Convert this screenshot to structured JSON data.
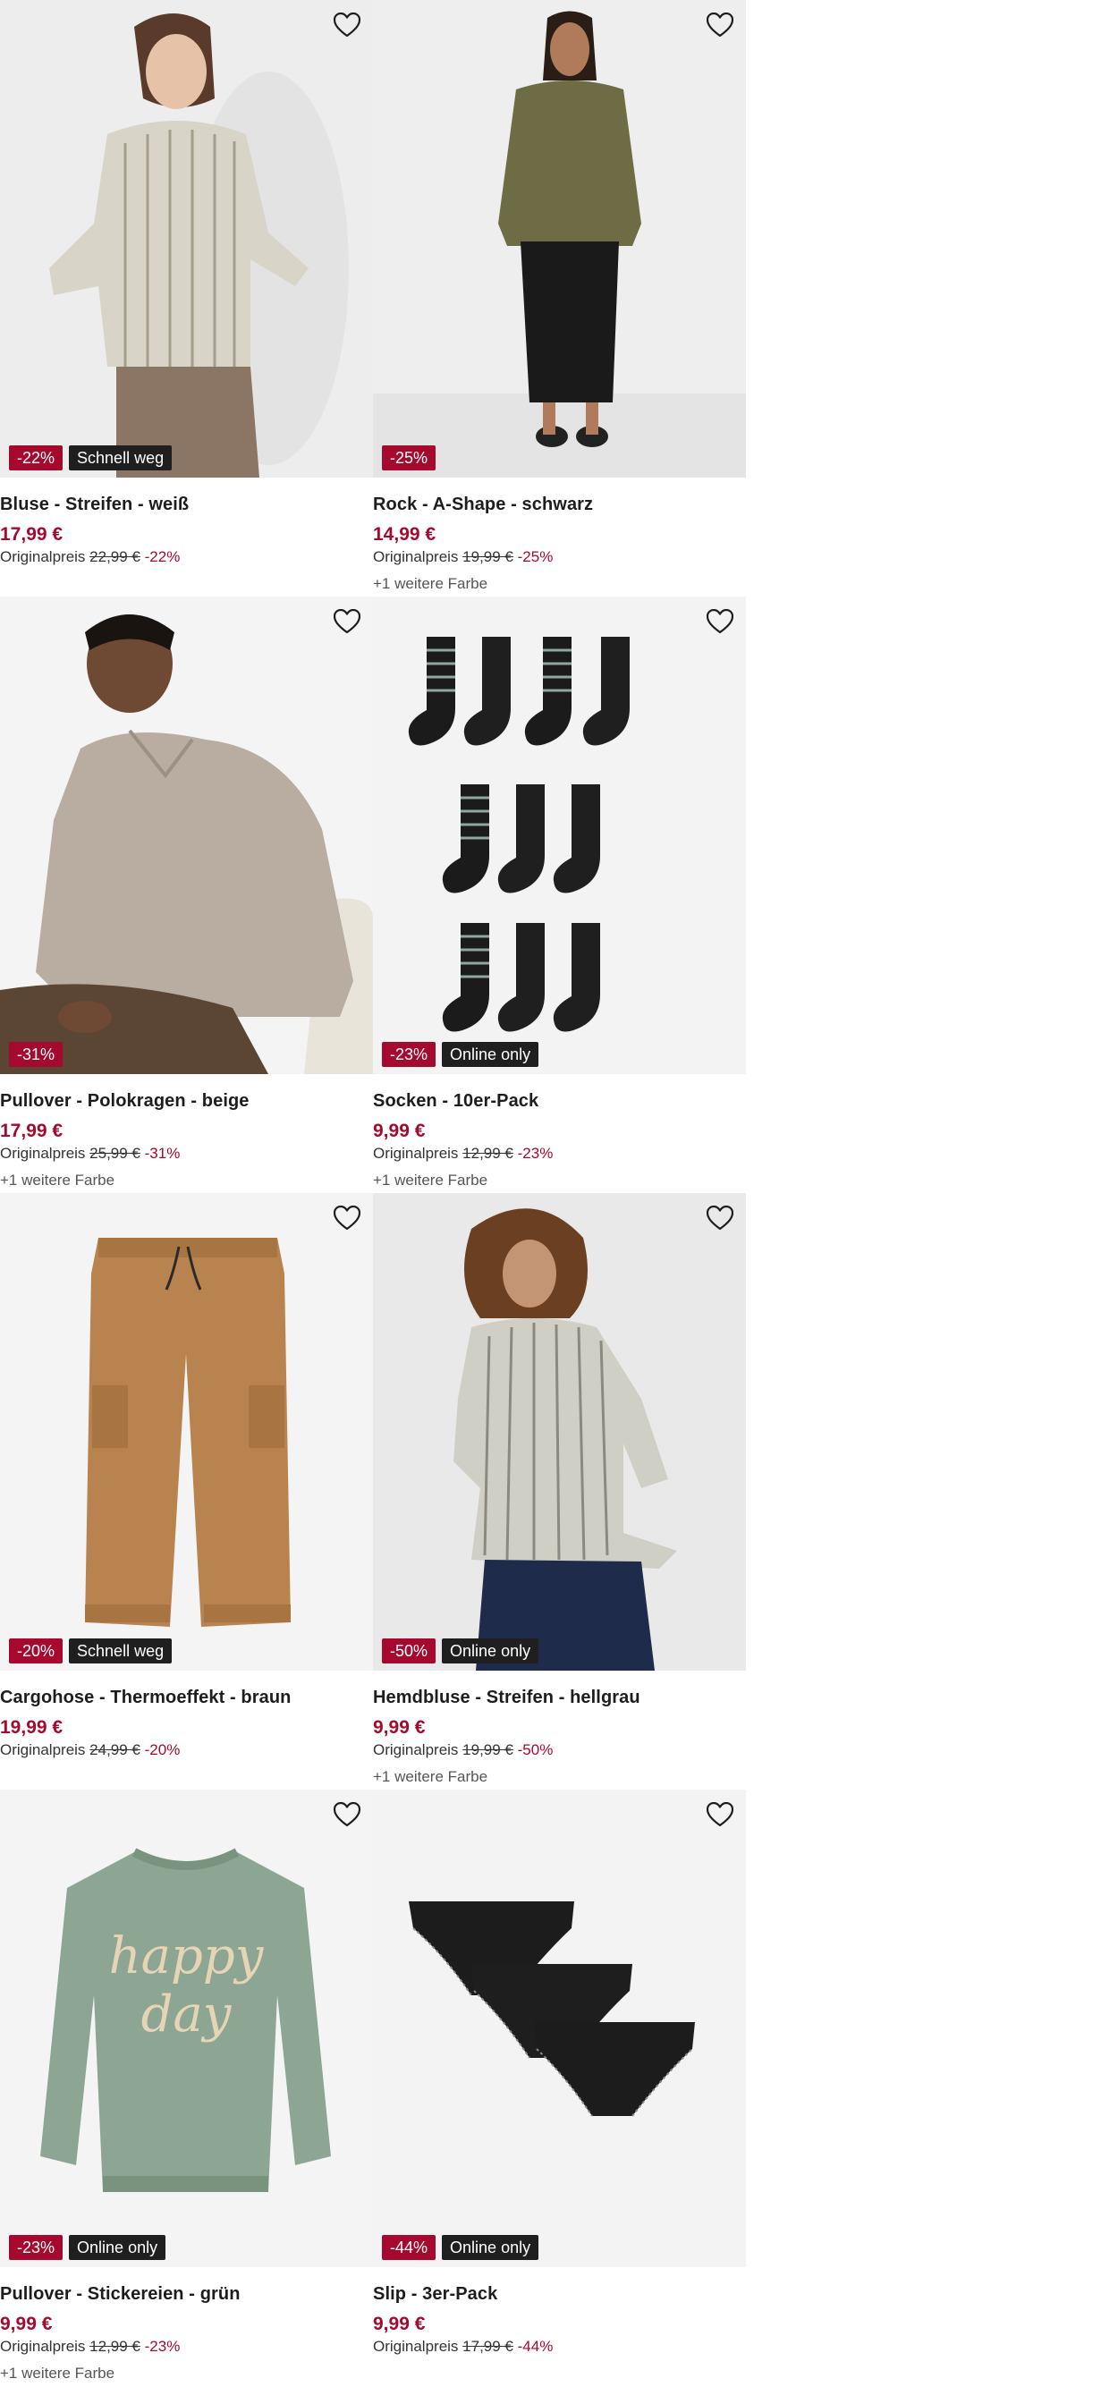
{
  "colors": {
    "accent": "#a50a2e",
    "badge_dark": "#1f1f1f",
    "image_bg": "#f2f2f2"
  },
  "products": [
    {
      "title": "Bluse - Streifen - weiß",
      "price": "17,99 €",
      "orig_label": "Originalpreis",
      "orig_price": "22,99 €",
      "discount": "-22%",
      "badge_discount": "-22%",
      "badge_label": "Schnell weg",
      "more_colors": "",
      "icon": "heart-icon"
    },
    {
      "title": "Rock - A-Shape - schwarz",
      "price": "14,99 €",
      "orig_label": "Originalpreis",
      "orig_price": "19,99 €",
      "discount": "-25%",
      "badge_discount": "-25%",
      "badge_label": "",
      "more_colors": "+1 weitere Farbe",
      "icon": "heart-icon"
    },
    {
      "title": "Pullover - Polokragen - beige",
      "price": "17,99 €",
      "orig_label": "Originalpreis",
      "orig_price": "25,99 €",
      "discount": "-31%",
      "badge_discount": "-31%",
      "badge_label": "",
      "more_colors": "+1 weitere Farbe",
      "icon": "heart-icon"
    },
    {
      "title": "Socken - 10er-Pack",
      "price": "9,99 €",
      "orig_label": "Originalpreis",
      "orig_price": "12,99 €",
      "discount": "-23%",
      "badge_discount": "-23%",
      "badge_label": "Online only",
      "more_colors": "+1 weitere Farbe",
      "icon": "heart-icon"
    },
    {
      "title": "Cargohose - Thermoeffekt - braun",
      "price": "19,99 €",
      "orig_label": "Originalpreis",
      "orig_price": "24,99 €",
      "discount": "-20%",
      "badge_discount": "-20%",
      "badge_label": "Schnell weg",
      "more_colors": "",
      "icon": "heart-icon"
    },
    {
      "title": "Hemdbluse - Streifen - hellgrau",
      "price": "9,99 €",
      "orig_label": "Originalpreis",
      "orig_price": "19,99 €",
      "discount": "-50%",
      "badge_discount": "-50%",
      "badge_label": "Online only",
      "more_colors": "+1 weitere Farbe",
      "icon": "heart-icon"
    },
    {
      "title": "Pullover - Stickereien - grün",
      "price": "9,99 €",
      "orig_label": "Originalpreis",
      "orig_price": "12,99 €",
      "discount": "-23%",
      "badge_discount": "-23%",
      "badge_label": "Online only",
      "more_colors": "+1 weitere Farbe",
      "icon": "heart-icon"
    },
    {
      "title": "Slip - 3er-Pack",
      "price": "9,99 €",
      "orig_label": "Originalpreis",
      "orig_price": "17,99 €",
      "discount": "-44%",
      "badge_discount": "-44%",
      "badge_label": "Online only",
      "more_colors": "",
      "icon": "heart-icon"
    }
  ]
}
